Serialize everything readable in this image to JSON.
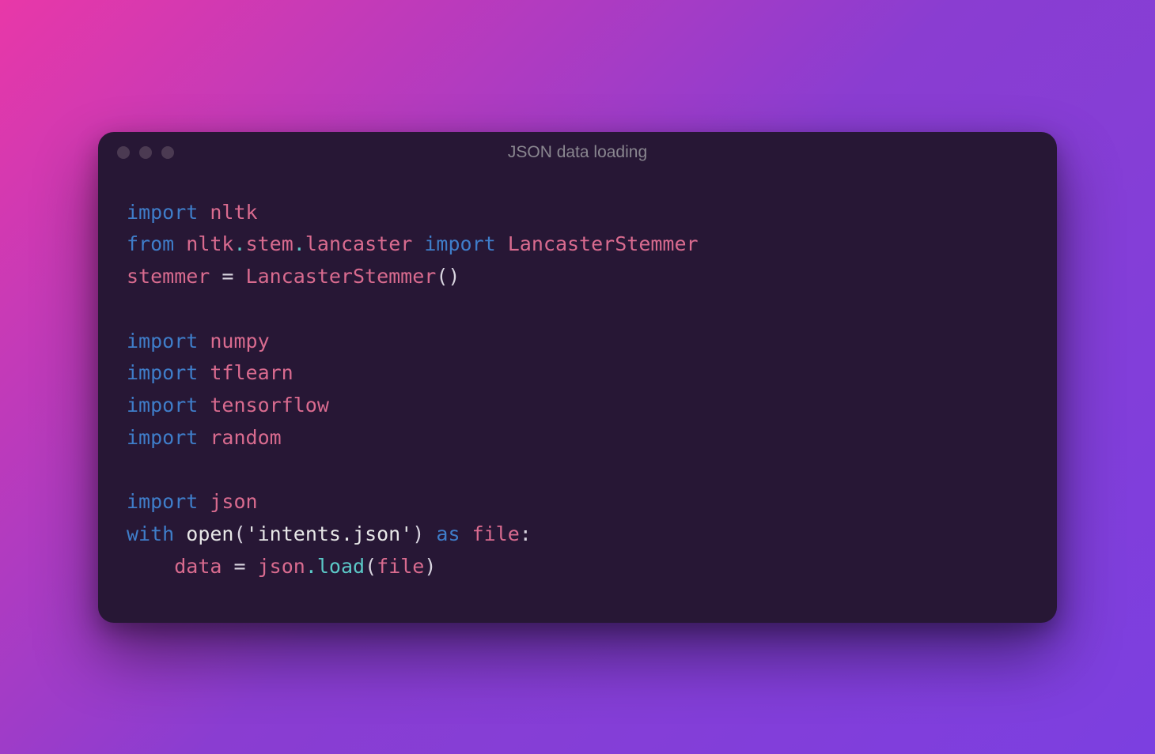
{
  "window": {
    "title": "JSON data loading"
  },
  "code": {
    "l1": {
      "import": "import",
      "nltk": "nltk"
    },
    "l2": {
      "from": "from",
      "nltk": "nltk",
      "dot1": ".",
      "stem": "stem",
      "dot2": ".",
      "lancaster": "lancaster",
      "import": "import",
      "LancasterStemmer": "LancasterStemmer"
    },
    "l3": {
      "stemmer": "stemmer",
      "eq": " = ",
      "LancasterStemmer": "LancasterStemmer",
      "parens": "()"
    },
    "l4": "",
    "l5": {
      "import": "import",
      "numpy": "numpy"
    },
    "l6": {
      "import": "import",
      "tflearn": "tflearn"
    },
    "l7": {
      "import": "import",
      "tensorflow": "tensorflow"
    },
    "l8": {
      "import": "import",
      "random": "random"
    },
    "l9": "",
    "l10": {
      "import": "import",
      "json": "json"
    },
    "l11": {
      "with": "with",
      "open": "open",
      "lp": "(",
      "str": "'intents.json'",
      "rp": ")",
      "as": "as",
      "file": "file",
      "colon": ":"
    },
    "l12": {
      "indent": "    ",
      "data": "data",
      "eq": " = ",
      "json": "json",
      "dot": ".",
      "load": "load",
      "lp": "(",
      "file": "file",
      "rp": ")"
    }
  }
}
